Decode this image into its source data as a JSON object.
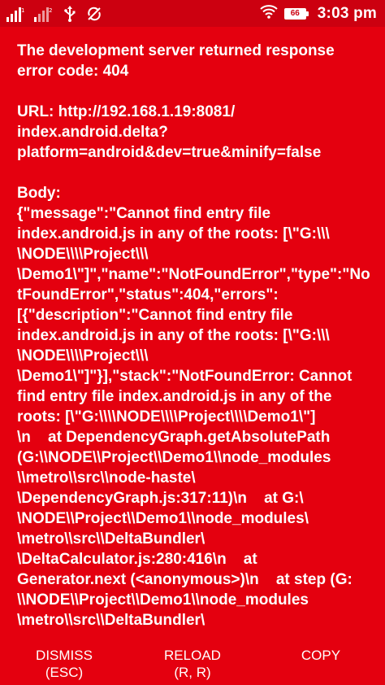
{
  "status_bar": {
    "time": "3:03 pm",
    "battery_level": "66",
    "icons": [
      "signal-bars-icon",
      "signal-bars-2-icon",
      "usb-icon",
      "no-sync-icon",
      "wifi-icon",
      "battery-icon"
    ]
  },
  "error": {
    "heading_lines": [
      "The development server returned response",
      "error code: 404"
    ],
    "url_lines": [
      "URL: http://192.168.1.19:8081/",
      "index.android.delta?",
      "platform=android&dev=true&minify=false"
    ],
    "body_lines": [
      "Body:",
      "{\"message\":\"Cannot find entry file",
      "index.android.js in any of the roots: [\\\"G:\\\\\\",
      "\\NODE\\\\\\\\Project\\\\\\",
      "\\Demo1\\\"]\",\"name\":\"NotFoundError\",\"type\":\"No",
      "tFoundError\",\"status\":404,\"errors\":",
      "[{\"description\":\"Cannot find entry file",
      "index.android.js in any of the roots: [\\\"G:\\\\\\",
      "\\NODE\\\\\\\\Project\\\\\\",
      "\\Demo1\\\"]\"}],\"stack\":\"NotFoundError: Cannot",
      "find entry file index.android.js in any of the",
      "roots: [\\\"G:\\\\\\\\NODE\\\\\\\\Project\\\\\\\\Demo1\\\"]",
      "\\n    at DependencyGraph.getAbsolutePath",
      "(G:\\\\NODE\\\\Project\\\\Demo1\\\\node_modules",
      "\\\\metro\\\\src\\\\node-haste\\",
      "\\DependencyGraph.js:317:11)\\n    at G:\\",
      "\\NODE\\\\Project\\\\Demo1\\\\node_modules\\",
      "\\metro\\\\src\\\\DeltaBundler\\",
      "\\DeltaCalculator.js:280:416\\n    at",
      "Generator.next (<anonymous>)\\n    at step (G:",
      "\\\\NODE\\\\Project\\\\Demo1\\\\node_modules",
      "\\metro\\\\src\\\\DeltaBundler\\"
    ]
  },
  "buttons": {
    "dismiss": {
      "label": "DISMISS",
      "shortcut": "(ESC)"
    },
    "reload": {
      "label": "RELOAD",
      "shortcut": "(R, R)"
    },
    "copy": {
      "label": "COPY"
    }
  },
  "colors": {
    "background": "#e4000f",
    "status_bar": "#cc0010",
    "text": "#ffffff"
  }
}
